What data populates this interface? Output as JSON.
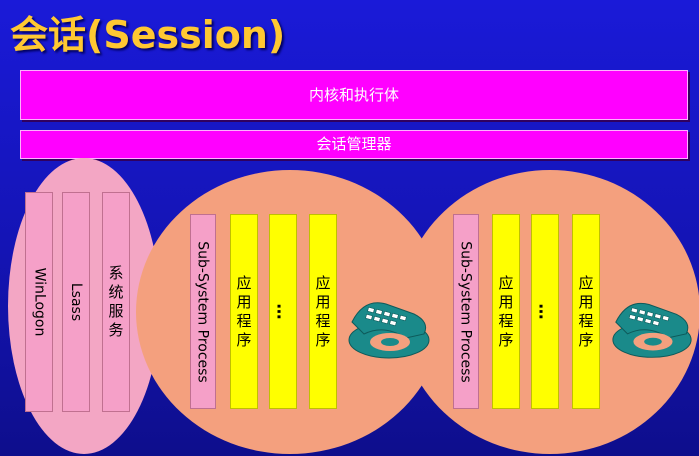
{
  "title": "会话(Session)",
  "kernel_bar": "内核和执行体",
  "session_manager_bar": "会话管理器",
  "session0": {
    "winlogon": "WinLogon",
    "lsass": "Lsass",
    "system_service": [
      "系",
      "统",
      "服",
      "务"
    ]
  },
  "session1": {
    "subsystem": "Sub-System Process",
    "app1": [
      "应",
      "用",
      "程",
      "序"
    ],
    "ellipsis": "…",
    "app2": [
      "应",
      "用",
      "程",
      "序"
    ],
    "icon": "telephone-keyboard-icon"
  },
  "session2": {
    "subsystem": "Sub-System Process",
    "app1": [
      "应",
      "用",
      "程",
      "序"
    ],
    "ellipsis": "…",
    "app2": [
      "应",
      "用",
      "程",
      "序"
    ],
    "icon": "telephone-keyboard-icon"
  },
  "colors": {
    "background": "#1414b4",
    "title": "#ffc832",
    "magenta_bar": "#ff00ff",
    "pink": "#f5a0c8",
    "salmon": "#f4a07e",
    "yellow": "#ffff00",
    "icon_teal": "#1a8a8a"
  }
}
